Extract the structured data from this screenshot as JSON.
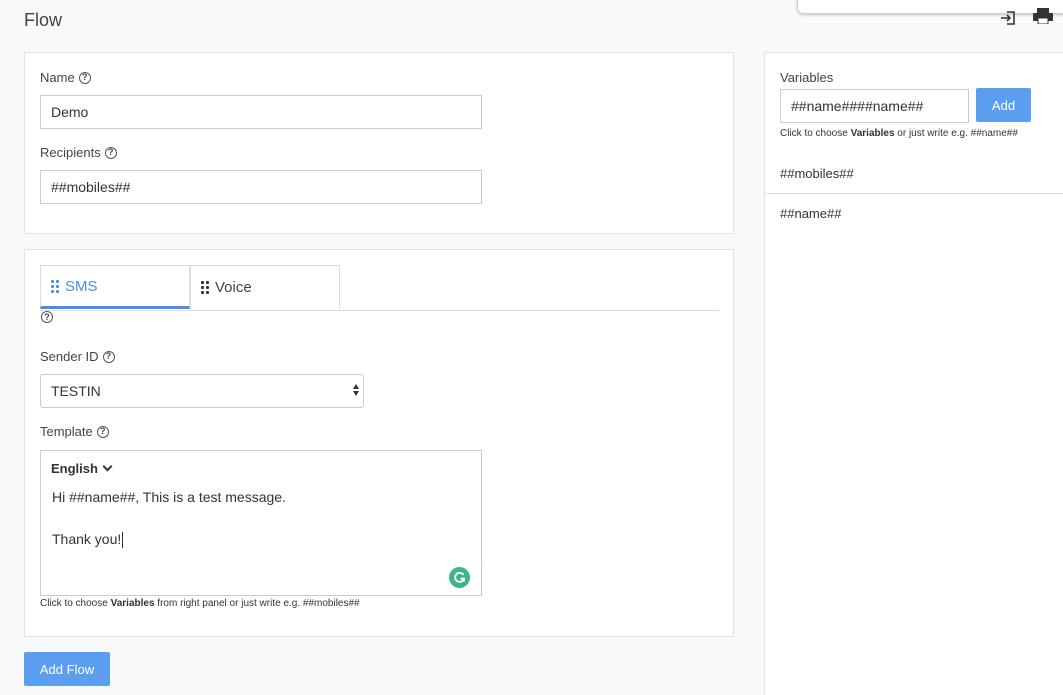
{
  "page": {
    "title": "Flow"
  },
  "flow_form": {
    "name_label": "Name",
    "name_value": "Demo",
    "recipients_label": "Recipients",
    "recipients_value": "##mobiles##"
  },
  "tabs": [
    {
      "label": "SMS",
      "active": true
    },
    {
      "label": "Voice",
      "active": false
    }
  ],
  "sms": {
    "sender_label": "Sender ID",
    "sender_value": "TESTIN",
    "template_label": "Template",
    "language": "English",
    "message_line1": "Hi ##name##, This is a test message.",
    "message_line2": "Thank you!",
    "hint_prefix": "Click to choose ",
    "hint_bold": "Variables",
    "hint_suffix": " from right panel or just write e.g. ##mobiles##"
  },
  "variables_panel": {
    "title": "Variables",
    "input_value": "##name####name##",
    "add_label": "Add",
    "hint_prefix": "Click to choose ",
    "hint_bold": "Variables",
    "hint_suffix": " or just write e.g. ##name##",
    "items": [
      "##mobiles##",
      "##name##"
    ]
  },
  "actions": {
    "add_flow_label": "Add Flow"
  },
  "colors": {
    "accent": "#5b9ef0",
    "tab_active": "#4a8ee6",
    "grammarly": "#3eb489"
  }
}
